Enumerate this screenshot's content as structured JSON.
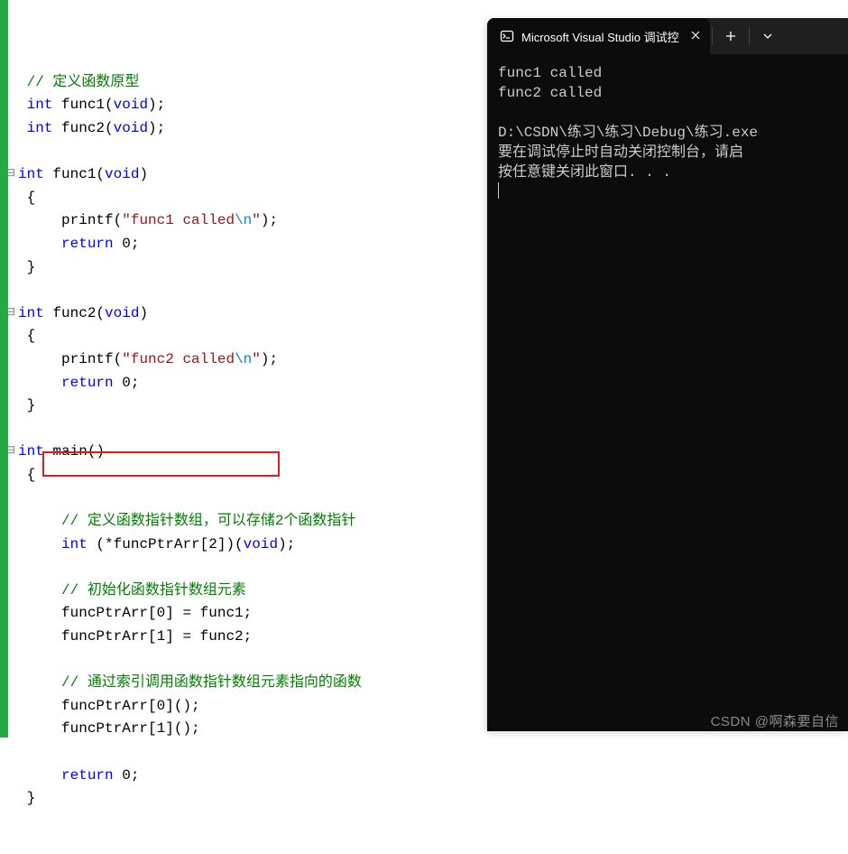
{
  "code": {
    "comment_prototype": "// 定义函数原型",
    "decl1_kw": "int",
    "decl1_name": " func1(",
    "decl1_void": "void",
    "decl1_end": ");",
    "decl2_kw": "int",
    "decl2_name": " func2(",
    "decl2_void": "void",
    "decl2_end": ");",
    "func1_sig_kw": "int",
    "func1_sig_name": " func1(",
    "func1_sig_void": "void",
    "func1_sig_end": ")",
    "func1_brace_open": "{",
    "func1_printf": "    printf(",
    "func1_str_a": "\"func1 called",
    "func1_esc": "\\n",
    "func1_str_b": "\"",
    "func1_printf_end": ");",
    "func1_return_kw": "return",
    "func1_return_rest": " 0;",
    "func1_brace_close": "}",
    "func2_sig_kw": "int",
    "func2_sig_name": " func2(",
    "func2_sig_void": "void",
    "func2_sig_end": ")",
    "func2_brace_open": "{",
    "func2_printf": "    printf(",
    "func2_str_a": "\"func2 called",
    "func2_esc": "\\n",
    "func2_str_b": "\"",
    "func2_printf_end": ");",
    "func2_return_kw": "return",
    "func2_return_rest": " 0;",
    "func2_brace_close": "}",
    "main_sig_kw": "int",
    "main_sig_name": " main()",
    "main_brace_open": "{",
    "comment_define_arr": "    // 定义函数指针数组，可以存储2个函数指针",
    "arr_decl_kw": "int",
    "arr_decl_mid": " (*funcPtrArr[2])(",
    "arr_decl_void": "void",
    "arr_decl_end": ");",
    "comment_init": "    // 初始化函数指针数组元素",
    "init0": "    funcPtrArr[0] = func1;",
    "init1": "    funcPtrArr[1] = func2;",
    "comment_call": "    // 通过索引调用函数指针数组元素指向的函数",
    "call0": "    funcPtrArr[0]();",
    "call1": "    funcPtrArr[1]();",
    "main_return_kw": "return",
    "main_return_rest": " 0;",
    "main_brace_close": "}"
  },
  "terminal": {
    "tab_title": "Microsoft Visual Studio 调试控",
    "line1": "func1 called",
    "line2": "func2 called",
    "path": "D:\\CSDN\\练习\\练习\\Debug\\练习.exe",
    "msg1": "要在调试停止时自动关闭控制台，请启",
    "msg2": "按任意键关闭此窗口. . ."
  },
  "watermark": "CSDN @啊森要自信"
}
